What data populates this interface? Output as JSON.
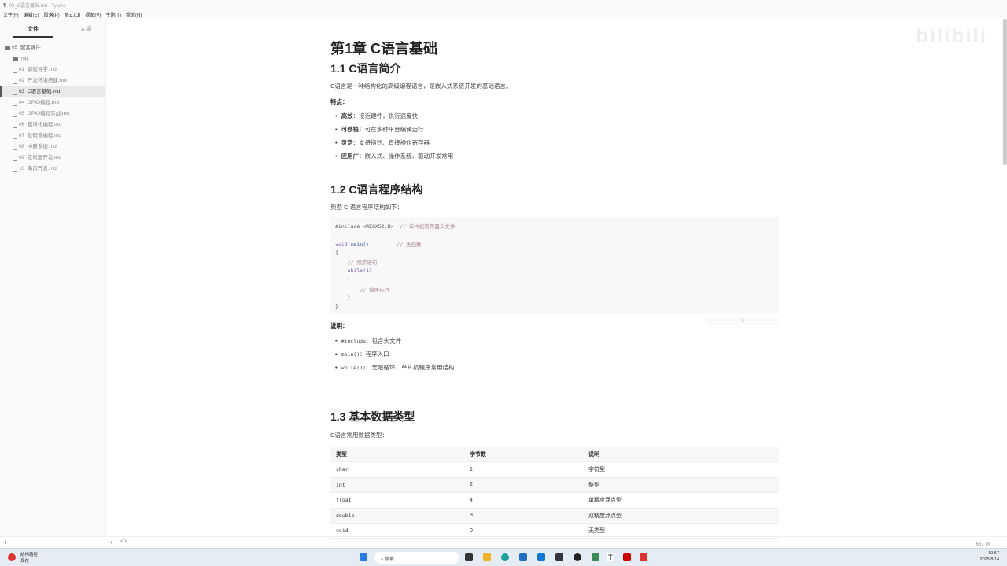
{
  "window": {
    "icon": "T",
    "title": "03_C语言基础.md - Typora"
  },
  "menu": [
    "文件(F)",
    "编辑(E)",
    "段落(P)",
    "格式(O)",
    "视图(V)",
    "主题(T)",
    "帮助(H)"
  ],
  "sidebar": {
    "tabs": [
      "文件",
      "大纲"
    ],
    "root": "05_配套课件",
    "items": [
      "img",
      "01_课程导学.md",
      "02_开发环境搭建.md",
      "03_C语言基础.md",
      "04_GPIO编程.md",
      "05_GPIO编程实战.md",
      "06_模块化编程.md",
      "07_数码管编程.md",
      "08_中断系统.md",
      "09_定时器开发.md",
      "10_串口开发.md"
    ]
  },
  "doc": {
    "h1": "第1章 C语言基础",
    "s1": {
      "title": "1.1 C语言简介",
      "intro": "C语言是一种结构化的高级编程语言，是嵌入式系统开发的基础语言。",
      "label": "特点：",
      "items": [
        {
          "b": "高效",
          "t": "：接近硬件，执行速度快"
        },
        {
          "b": "可移植",
          "t": "：可在多种平台编译运行"
        },
        {
          "b": "灵活",
          "t": "：支持指针、直接操作寄存器"
        },
        {
          "b": "应用广",
          "t": "：嵌入式、操作系统、驱动开发常用"
        }
      ]
    },
    "s2": {
      "title": "1.2 C语言程序结构",
      "intro": "典型 C 语言程序结构如下：",
      "code": {
        "l1": "#include <REGX52.H>",
        "c1": "// 单片机寄存器头文件",
        "l3a": "void ",
        "l3b": "main()",
        "c3": "// 主函数",
        "l4": "{",
        "c5": "// 程序语句",
        "l6": "while(1)",
        "l7": "{",
        "c8": "// 循环执行",
        "l9": "}",
        "l10": "}",
        "lang": "c"
      },
      "label": "说明：",
      "items": [
        {
          "c": "#include",
          "t": "：包含头文件"
        },
        {
          "c": "main()",
          "t": "：程序入口"
        },
        {
          "c": "while(1)",
          "t": "：无限循环，单片机程序常用结构"
        }
      ]
    },
    "s3": {
      "title": "1.3 基本数据类型",
      "intro": "C语言常用数据类型：",
      "headers": [
        "类型",
        "字节数",
        "说明"
      ],
      "rows": [
        [
          "char",
          "1",
          "字符型"
        ],
        [
          "int",
          "2",
          "整型"
        ],
        [
          "float",
          "4",
          "单精度浮点型"
        ],
        [
          "double",
          "8",
          "双精度浮点型"
        ],
        [
          "void",
          "0",
          "无类型"
        ]
      ]
    }
  },
  "status": {
    "words": "637 词"
  },
  "taskbar": {
    "weather": "结构路径",
    "weather2": "现在",
    "search": "搜索",
    "time": "19:57",
    "date": "2025/8/14"
  },
  "watermark": "bilibili"
}
